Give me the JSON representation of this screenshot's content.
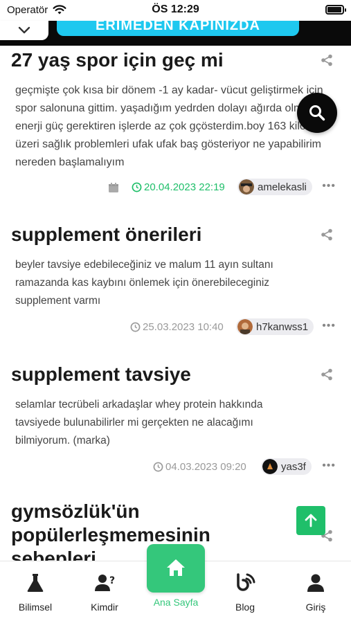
{
  "status_bar": {
    "carrier": "Operatör",
    "time": "ÖS 12:29"
  },
  "banner": {
    "text": "ERİMEDEN KAPINIZDA"
  },
  "posts": [
    {
      "title": "27 yaş spor için geç mi",
      "body": "geçmişte çok kısa bir dönem -1 ay kadar- vücut geliştirmek için spor salonuna gittim. yaşadığım yedrden dolayı ağırda olmasada enerji güç gerektiren işlerde az çok gçösterdim.boy 163 kilo 80 üzeri sağlık problemleri ufak ufak baş gösteriyor ne yapabilirim nereden başlamalıyım",
      "date": "20.04.2023 22:19",
      "user": "amelekasli",
      "date_color": "#1fbf6a"
    },
    {
      "title": "supplement önerileri",
      "body": "beyler tavsiye edebileceğiniz ve malum 11 ayın sultanı ramazanda kas kaybını önlemek için önerebileceginiz supplement varmı",
      "date": "25.03.2023 10:40",
      "user": "h7kanwss1",
      "date_color": "#9a9a9a"
    },
    {
      "title": "supplement tavsiye",
      "body": "selamlar tecrübeli arkadaşlar whey protein hakkında tavsiyede bulunabilirler mi gerçekten ne alacağımı bilmiyorum. (marka)",
      "date": "04.03.2023 09:20",
      "user": "yas3f",
      "date_color": "#9a9a9a"
    },
    {
      "title": "gymsözlük'ün popülerleşmemesinin sebepleri"
    }
  ],
  "more_label": "•••",
  "nav": {
    "bilimsel": "Bilimsel",
    "kimdir": "Kimdir",
    "home": "Ana Sayfa",
    "blog": "Blog",
    "giris": "Giriş"
  },
  "colors": {
    "accent": "#34c77b",
    "scroll_top": "#1fbf6a",
    "banner": "#1ec8ef"
  }
}
